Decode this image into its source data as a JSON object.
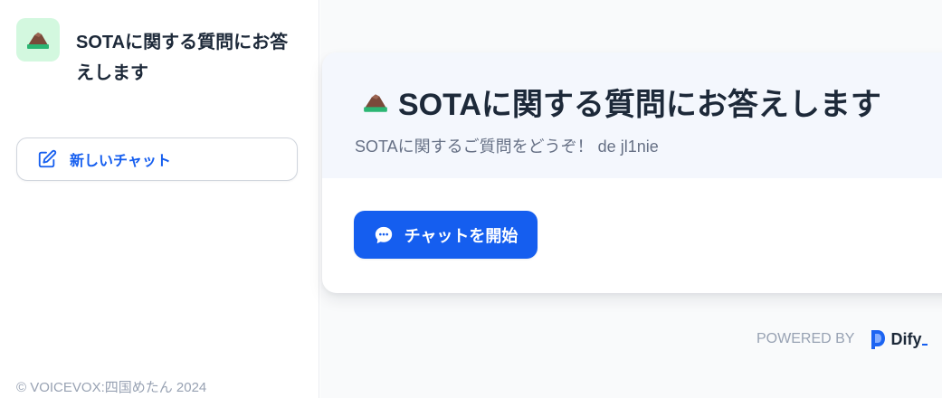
{
  "sidebar": {
    "app_title": "SOTAに関する質問にお答えします",
    "new_chat_label": "新しいチャット",
    "copyright": "© VOICEVOX:四国めたん 2024"
  },
  "welcome": {
    "title": "SOTAに関する質問にお答えします",
    "description": "SOTAに関するご質問をどうぞ！ de jl1nie",
    "start_button": "チャットを開始"
  },
  "footer": {
    "powered_by": "POWERED BY",
    "brand": "Dify"
  },
  "icons": {
    "app": "mountain-icon",
    "new_chat": "edit-icon",
    "start_chat": "chat-bubble-icon",
    "brand": "dify-logo-icon"
  },
  "colors": {
    "accent": "#155eef",
    "app_icon_bg": "#d3f8df",
    "header_bg": "#f4f7fd"
  }
}
